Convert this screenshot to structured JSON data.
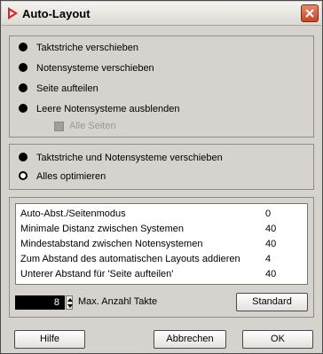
{
  "window": {
    "title": "Auto-Layout"
  },
  "group1": {
    "options": [
      "Taktstriche verschieben",
      "Notensysteme verschieben",
      "Seite aufteilen",
      "Leere Notensysteme ausblenden"
    ],
    "checkbox_label": "Alle Seiten"
  },
  "group2": {
    "options": [
      "Taktstriche und Notensysteme verschieben",
      "Alles optimieren"
    ],
    "selected": "Taktstriche und Notensysteme verschieben"
  },
  "params": {
    "rows": [
      {
        "label": "Auto-Abst./Seitenmodus",
        "value": "0"
      },
      {
        "label": "Minimale Distanz zwischen Systemen",
        "value": "40"
      },
      {
        "label": "Mindestabstand zwischen Notensystemen",
        "value": "40"
      },
      {
        "label": "Zum Abstand des automatischen Layouts addieren",
        "value": "4"
      },
      {
        "label": "Unterer Abstand für 'Seite aufteilen'",
        "value": "40"
      }
    ],
    "max_bars_value": "8",
    "max_bars_label": "Max. Anzahl Takte",
    "standard_button": "Standard"
  },
  "footer": {
    "help": "Hilfe",
    "cancel": "Abbrechen",
    "ok": "OK"
  }
}
